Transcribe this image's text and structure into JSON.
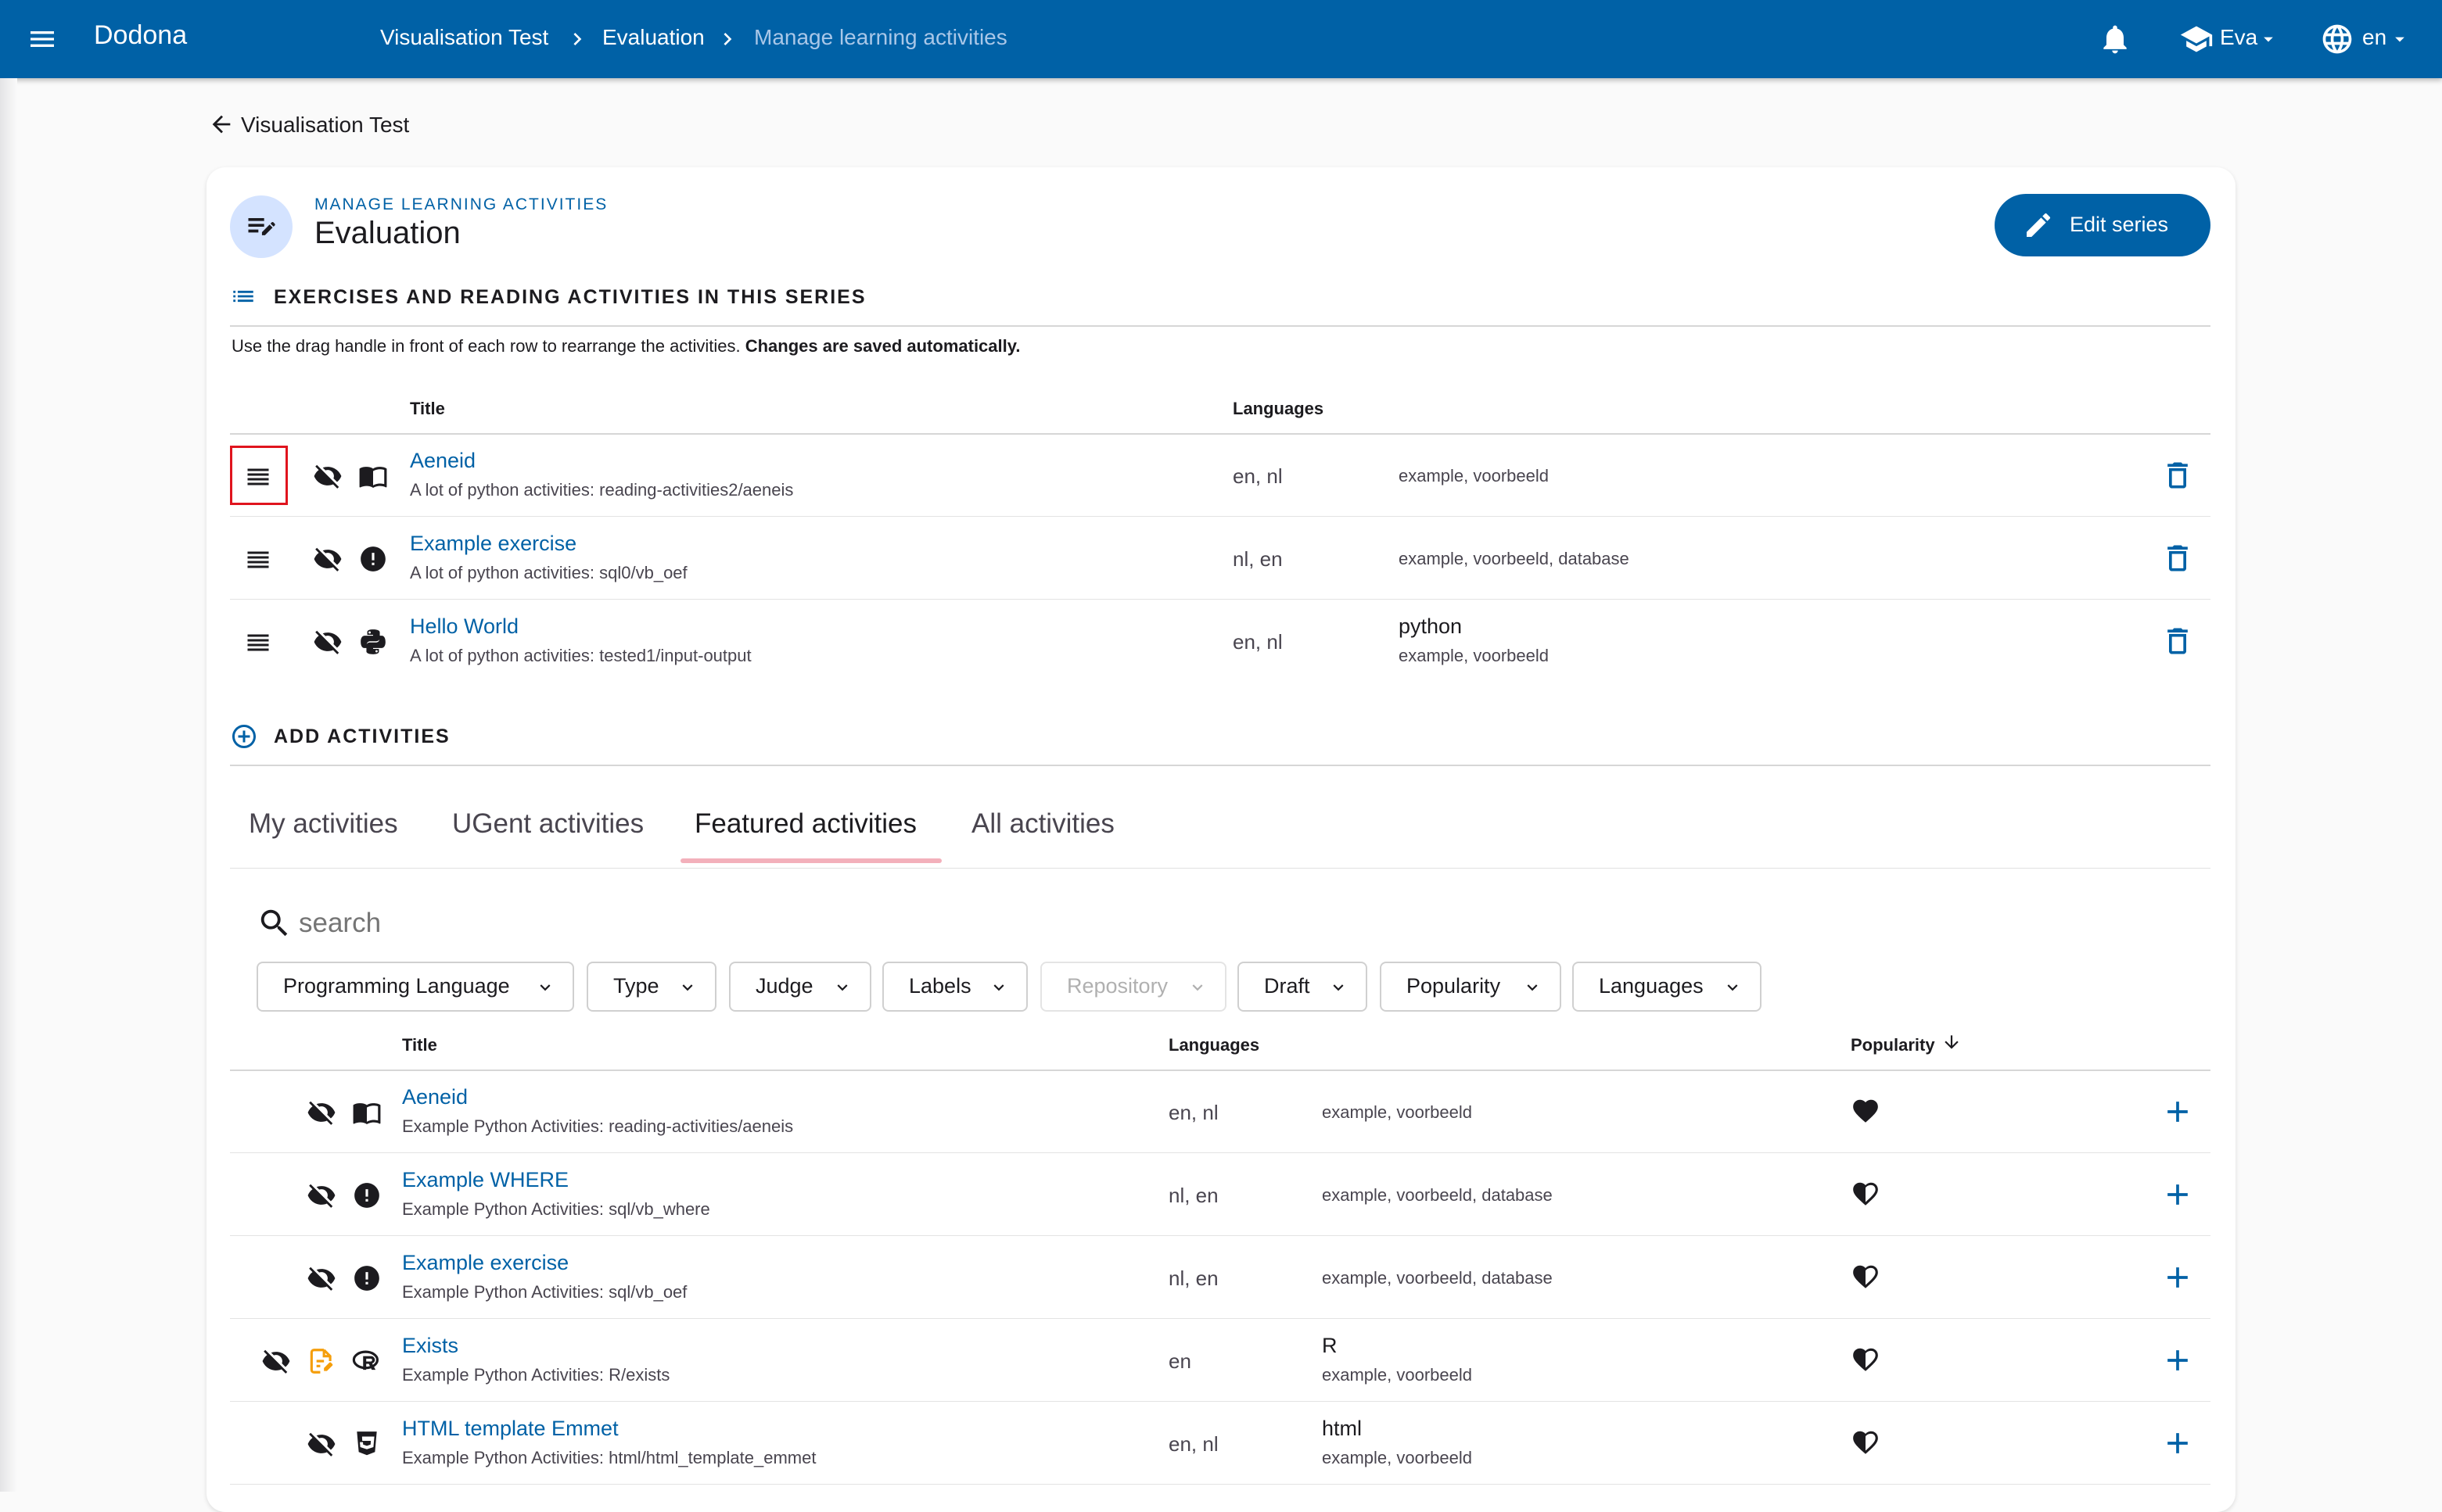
{
  "appbar": {
    "brand": "Dodona",
    "breadcrumb": [
      "Visualisation Test",
      "Evaluation",
      "Manage learning activities"
    ],
    "user": "Eva",
    "language": "en"
  },
  "back_link": "Visualisation Test",
  "card": {
    "eyebrow": "MANAGE LEARNING ACTIVITIES",
    "title": "Evaluation",
    "edit_button": "Edit series"
  },
  "series_section": {
    "heading": "EXERCISES AND READING ACTIVITIES IN THIS SERIES",
    "hint_plain": "Use the drag handle in front of each row to rearrange the activities.",
    "hint_bold": "Changes are saved automatically.",
    "col_title": "Title",
    "col_languages": "Languages",
    "rows": [
      {
        "title": "Aeneid",
        "sub": "A lot of python activities: reading-activities2/aeneis",
        "langs": "en, nl",
        "prog": "",
        "labels": "example, voorbeeld",
        "type_icon": "book-icon"
      },
      {
        "title": "Example exercise",
        "sub": "A lot of python activities: sql0/vb_oef",
        "langs": "nl, en",
        "prog": "",
        "labels": "example, voorbeeld, database",
        "type_icon": "alert-circle-icon"
      },
      {
        "title": "Hello World",
        "sub": "A lot of python activities: tested1/input-output",
        "langs": "en, nl",
        "prog": "python",
        "labels": "example, voorbeeld",
        "type_icon": "python-icon"
      }
    ]
  },
  "add_section": {
    "heading": "ADD ACTIVITIES",
    "tabs": [
      "My activities",
      "UGent activities",
      "Featured activities",
      "All activities"
    ],
    "active_tab": "Featured activities",
    "search_placeholder": "search",
    "filters": [
      "Programming Language",
      "Type",
      "Judge",
      "Labels",
      "Repository",
      "Draft",
      "Popularity",
      "Languages"
    ],
    "disabled_filter": "Repository",
    "col_title": "Title",
    "col_languages": "Languages",
    "col_popularity": "Popularity",
    "rows": [
      {
        "title": "Aeneid",
        "sub": "Example Python Activities: reading-activities/aeneis",
        "langs": "en, nl",
        "prog": "",
        "labels": "example, voorbeeld",
        "type_icon": "book-icon",
        "draft": false
      },
      {
        "title": "Example WHERE",
        "sub": "Example Python Activities: sql/vb_where",
        "langs": "nl, en",
        "prog": "",
        "labels": "example, voorbeeld, database",
        "type_icon": "alert-circle-icon",
        "draft": false
      },
      {
        "title": "Example exercise",
        "sub": "Example Python Activities: sql/vb_oef",
        "langs": "nl, en",
        "prog": "",
        "labels": "example, voorbeeld, database",
        "type_icon": "alert-circle-icon",
        "draft": false
      },
      {
        "title": "Exists",
        "sub": "Example Python Activities: R/exists",
        "langs": "en",
        "prog": "R",
        "labels": "example, voorbeeld",
        "type_icon": "r-language-icon",
        "draft": true
      },
      {
        "title": "HTML template Emmet",
        "sub": "Example Python Activities: html/html_template_emmet",
        "langs": "en, nl",
        "prog": "html",
        "labels": "example, voorbeeld",
        "type_icon": "html5-icon",
        "draft": false
      }
    ]
  },
  "colors": {
    "primary": "#0061a6",
    "tab_indicator": "#f3b0bb",
    "draft": "#f59e0b",
    "selection": "#e0141e"
  }
}
